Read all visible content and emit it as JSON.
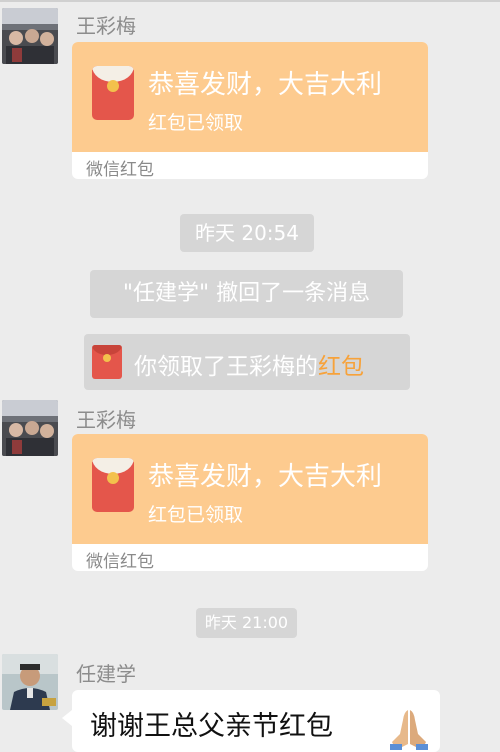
{
  "messages": [
    {
      "sender": "王彩梅",
      "type": "red_packet",
      "title": "恭喜发财，大吉大利",
      "status": "红包已领取",
      "footer": "微信红包"
    },
    {
      "sender": "王彩梅",
      "type": "red_packet",
      "title": "恭喜发财，大吉大利",
      "status": "红包已领取",
      "footer": "微信红包"
    },
    {
      "sender": "任建学",
      "type": "text",
      "text": "谢谢王总父亲节红包",
      "emoji": "praying-hands"
    }
  ],
  "timestamps": [
    "昨天 20:54",
    "昨天 21:00"
  ],
  "system": {
    "recall_notice": "\"任建学\" 撤回了一条消息",
    "claimed_prefix": "你领取了王彩梅的",
    "claimed_link": "红包"
  },
  "colors": {
    "chat_background": "#ececec",
    "red_packet_bubble": "#fdcb8f",
    "red_packet_icon": "#e4564b",
    "system_pill": "#d6d6d6",
    "link_orange": "#f7a23a"
  }
}
